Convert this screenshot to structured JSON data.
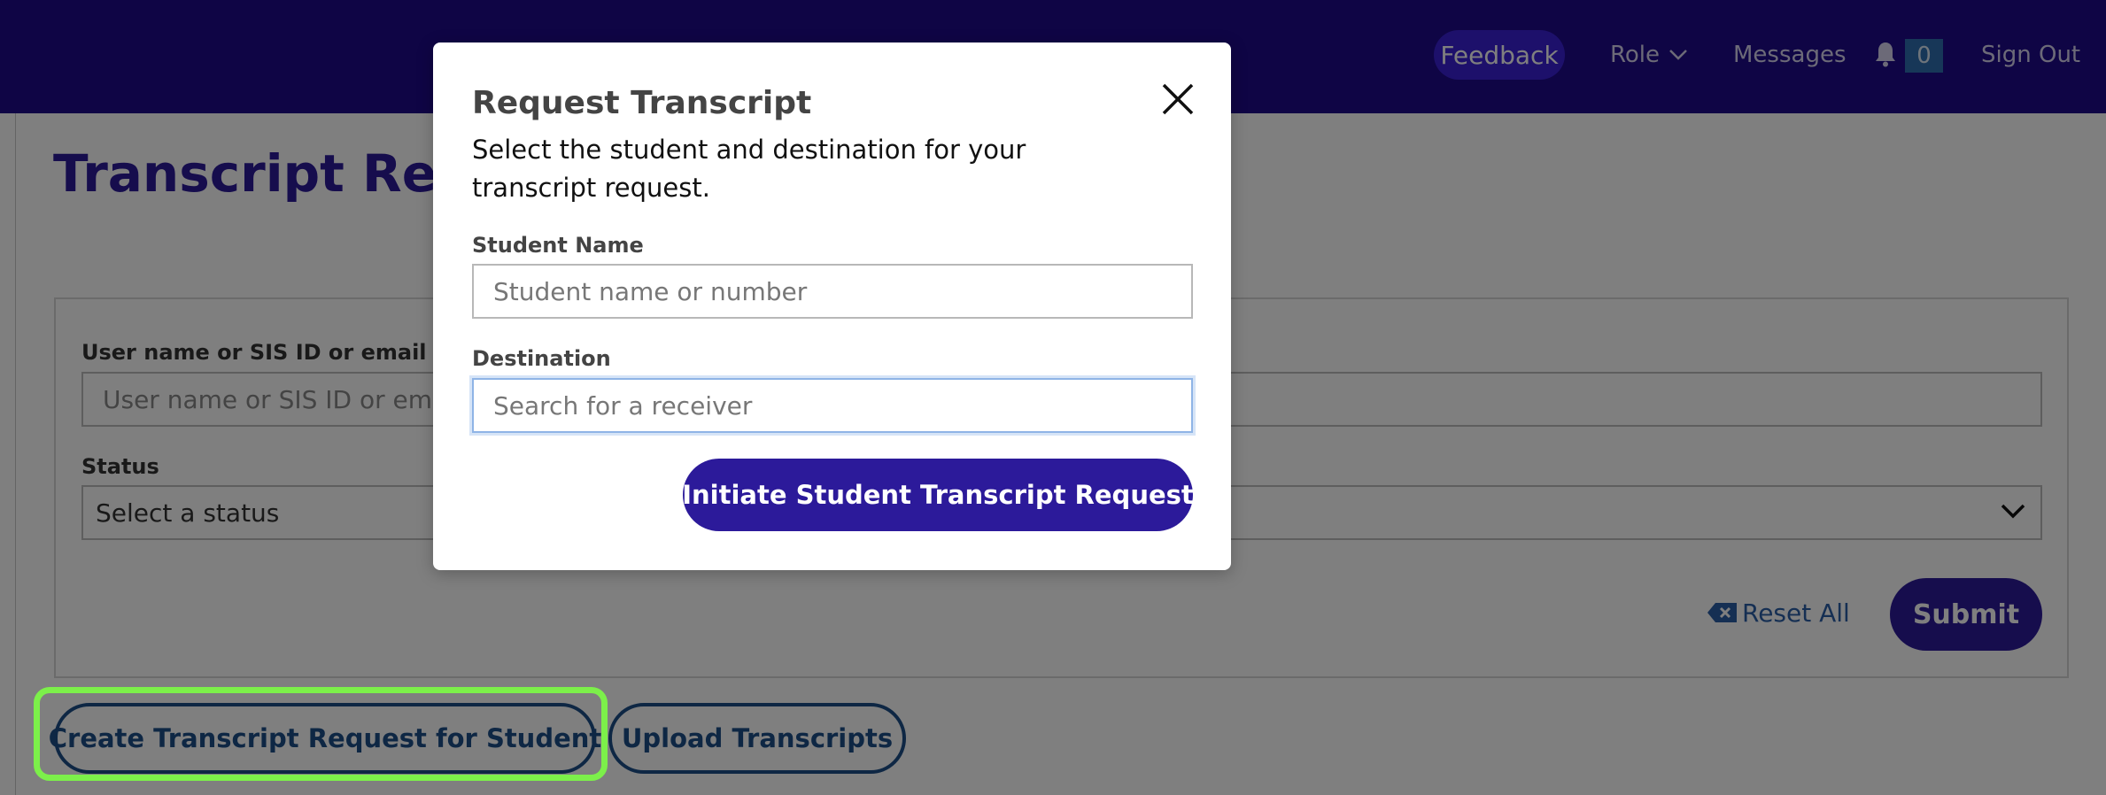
{
  "nav": {
    "feedback": "Feedback",
    "role": "Role",
    "messages": "Messages",
    "notification_count": "0",
    "sign_out": "Sign Out"
  },
  "page": {
    "title": "Transcript Req",
    "filters": {
      "user_label": "User name or SIS ID or email",
      "user_placeholder": "User name or SIS ID or emai",
      "status_label": "Status",
      "status_value": "Select a status",
      "reset_label": "Reset All",
      "submit_label": "Submit"
    },
    "actions": {
      "create_label": "Create Transcript Request for Student",
      "upload_label": "Upload Transcripts"
    }
  },
  "modal": {
    "title": "Request Transcript",
    "description": "Select the student and destination for your transcript request.",
    "student_label": "Student Name",
    "student_placeholder": "Student name or number",
    "destination_label": "Destination",
    "destination_placeholder": "Search for a receiver",
    "initiate_label": "Initiate Student Transcript Request"
  },
  "colors": {
    "brand_dark": "#1e0a8a",
    "brand_primary": "#2c1a9a",
    "link_blue": "#1d4e89",
    "highlight_green": "#7cf04a"
  },
  "icons": {
    "close": "close-icon",
    "bell": "bell-icon",
    "chevron": "chevron-down-icon",
    "reset": "backspace-x-icon"
  }
}
